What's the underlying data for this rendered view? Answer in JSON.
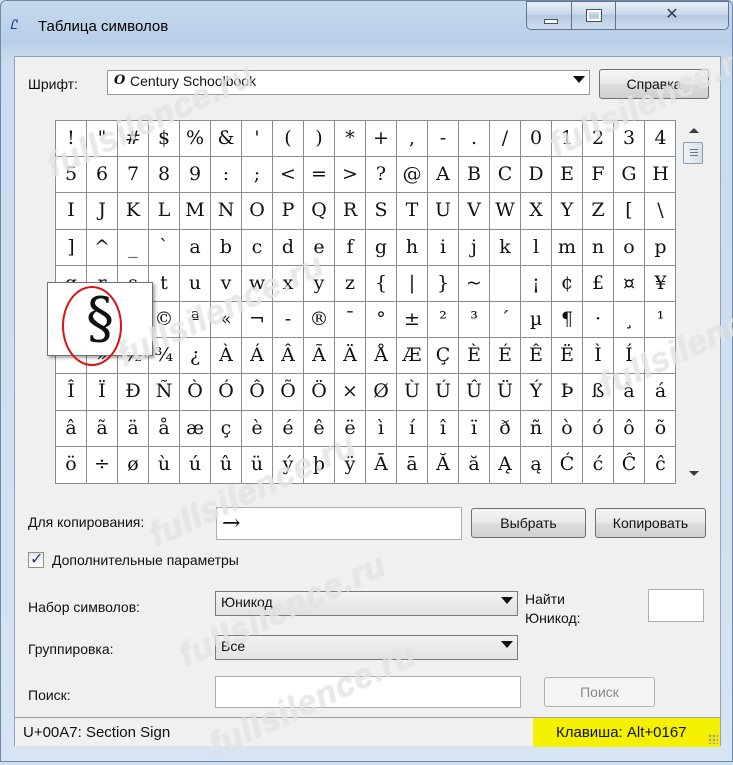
{
  "window": {
    "title": "Таблица символов",
    "icon": "charmap-icon",
    "close_glyph": "✕"
  },
  "font": {
    "label": "Шрифт:",
    "value": "Century Schoolbook",
    "help_button": "Справка"
  },
  "grid": {
    "rows": [
      [
        "!",
        "\"",
        "#",
        "$",
        "%",
        "&",
        "'",
        "(",
        ")",
        "*",
        "+",
        ",",
        "-",
        ".",
        "/",
        "0",
        "1",
        "2",
        "3",
        "4"
      ],
      [
        "5",
        "6",
        "7",
        "8",
        "9",
        ":",
        ";",
        "<",
        "=",
        ">",
        "?",
        "@",
        "A",
        "B",
        "C",
        "D",
        "E",
        "F",
        "G",
        "H"
      ],
      [
        "I",
        "J",
        "K",
        "L",
        "M",
        "N",
        "O",
        "P",
        "Q",
        "R",
        "S",
        "T",
        "U",
        "V",
        "W",
        "X",
        "Y",
        "Z",
        "[",
        "\\"
      ],
      [
        "]",
        "^",
        "_",
        "`",
        "a",
        "b",
        "c",
        "d",
        "e",
        "f",
        "g",
        "h",
        "i",
        "j",
        "k",
        "l",
        "m",
        "n",
        "o",
        "p"
      ],
      [
        "q",
        "r",
        "s",
        "t",
        "u",
        "v",
        "w",
        "x",
        "y",
        "z",
        "{",
        "|",
        "}",
        "~",
        " ",
        "¡",
        "¢",
        "£",
        "¤",
        "¥"
      ],
      [
        "¦",
        "§",
        "¨",
        "©",
        "ª",
        "«",
        "¬",
        "-",
        "®",
        "¯",
        "°",
        "±",
        "²",
        "³",
        "´",
        "µ",
        "¶",
        "·",
        "¸",
        "¹"
      ],
      [
        "º",
        "»",
        "½",
        "¾",
        "¿",
        "À",
        "Á",
        "Â",
        "Ã",
        "Ä",
        "Å",
        "Æ",
        "Ç",
        "È",
        "É",
        "Ê",
        "Ë",
        "Ì",
        "Í",
        ""
      ],
      [
        "Î",
        "Ï",
        "Ð",
        "Ñ",
        "Ò",
        "Ó",
        "Ô",
        "Õ",
        "Ö",
        "×",
        "Ø",
        "Ù",
        "Ú",
        "Û",
        "Ü",
        "Ý",
        "Þ",
        "ß",
        "à",
        "á"
      ],
      [
        "â",
        "ã",
        "ä",
        "å",
        "æ",
        "ç",
        "è",
        "é",
        "ê",
        "ë",
        "ì",
        "í",
        "î",
        "ï",
        "ð",
        "ñ",
        "ò",
        "ó",
        "ô",
        "õ"
      ],
      [
        "ö",
        "÷",
        "ø",
        "ù",
        "ú",
        "û",
        "ü",
        "ý",
        "þ",
        "ÿ",
        "Ā",
        "ā",
        "Ă",
        "ă",
        "Ą",
        "ą",
        "Ć",
        "ć",
        "Ĉ",
        "ĉ"
      ]
    ],
    "zoom_char": "§"
  },
  "copy": {
    "label": "Для копирования:",
    "value": "→",
    "select_button": "Выбрать",
    "copy_button": "Копировать"
  },
  "advanced": {
    "checkbox_label": "Дополнительные параметры",
    "checked": true
  },
  "charset": {
    "label": "Набор символов:",
    "value": "Юникод",
    "goto_label_line1": "Найти",
    "goto_label_line2": "Юникод:"
  },
  "grouping": {
    "label": "Группировка:",
    "value": "Все"
  },
  "search": {
    "label": "Поиск:",
    "button": "Поиск"
  },
  "status": {
    "char_info": "U+00A7: Section Sign",
    "keystroke": "Клавиша: Alt+0167",
    "highlight_color": "#f4f000"
  },
  "watermark": "fullsilence.ru"
}
